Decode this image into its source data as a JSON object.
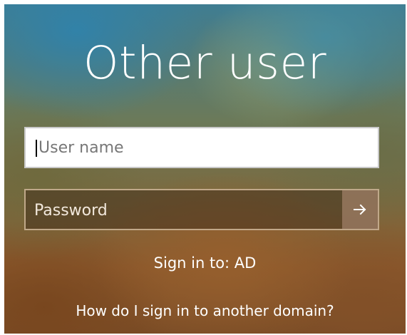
{
  "login": {
    "title": "Other user",
    "username_placeholder": "User name",
    "username_value": "",
    "password_placeholder": "Password",
    "password_value": "",
    "submit_icon": "arrow-right-icon",
    "sign_in_to": "Sign in to: AD",
    "help_link": "How do I sign in to another domain?"
  },
  "colors": {
    "input_background": "#ffffff",
    "password_background": "#5b3c20",
    "text_primary": "#ffffff"
  }
}
